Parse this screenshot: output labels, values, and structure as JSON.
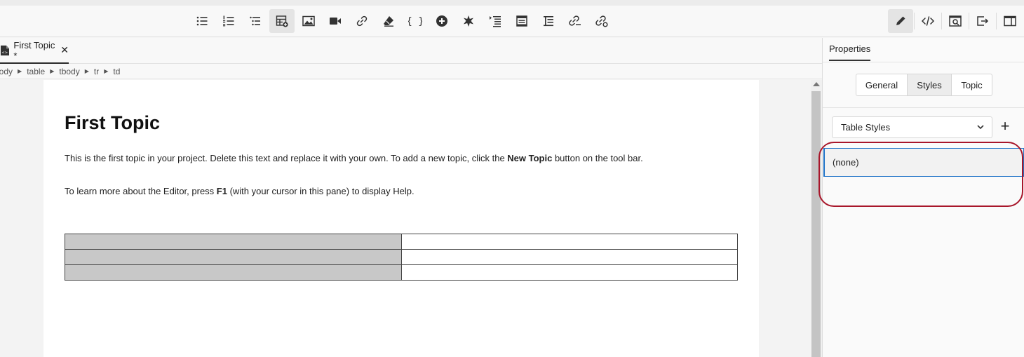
{
  "app": {
    "accent_color": "#1f73c8",
    "highlight_color": "#a8162a"
  },
  "toolbar": {
    "left_tools": [
      {
        "name": "bulleted-list-icon"
      },
      {
        "name": "numbered-list-icon"
      },
      {
        "name": "multilevel-list-icon"
      },
      {
        "name": "insert-table-icon",
        "active": true
      },
      {
        "name": "insert-image-icon"
      },
      {
        "name": "insert-video-icon"
      },
      {
        "name": "insert-link-icon"
      },
      {
        "name": "clear-format-icon"
      },
      {
        "name": "code-snippet-icon"
      },
      {
        "name": "add-circle-icon"
      },
      {
        "name": "variable-icon"
      },
      {
        "name": "indent-list-icon"
      },
      {
        "name": "condition-icon"
      },
      {
        "name": "tree-icon"
      },
      {
        "name": "link-edit-icon"
      },
      {
        "name": "link-settings-icon"
      }
    ],
    "right_tools": [
      {
        "name": "edit-pencil-icon",
        "active": true
      },
      {
        "name": "source-code-icon"
      },
      {
        "name": "preview-icon"
      },
      {
        "name": "export-icon"
      },
      {
        "name": "panel-toggle-icon"
      }
    ]
  },
  "tab": {
    "label": "First Topic *",
    "close": "✕"
  },
  "breadcrumb": [
    "body",
    "table",
    "tbody",
    "tr",
    "td"
  ],
  "document": {
    "title": "First Topic",
    "p1_before": "This is the first topic in your project. Delete this text and replace it with your own. To add a new topic, click the ",
    "p1_bold": "New Topic",
    "p1_after": " button on the tool bar.",
    "p2_before": "To learn more about the Editor, press ",
    "p2_bold": "F1",
    "p2_after": " (with your cursor in this pane) to display Help.",
    "table_rows": 3,
    "table_cols": 2
  },
  "properties": {
    "title": "Properties",
    "tabs": [
      {
        "label": "General",
        "selected": false
      },
      {
        "label": "Styles",
        "selected": true
      },
      {
        "label": "Topic",
        "selected": false
      }
    ],
    "dropdown_value": "Table Styles",
    "add_symbol": "+",
    "style_item": "(none)"
  }
}
